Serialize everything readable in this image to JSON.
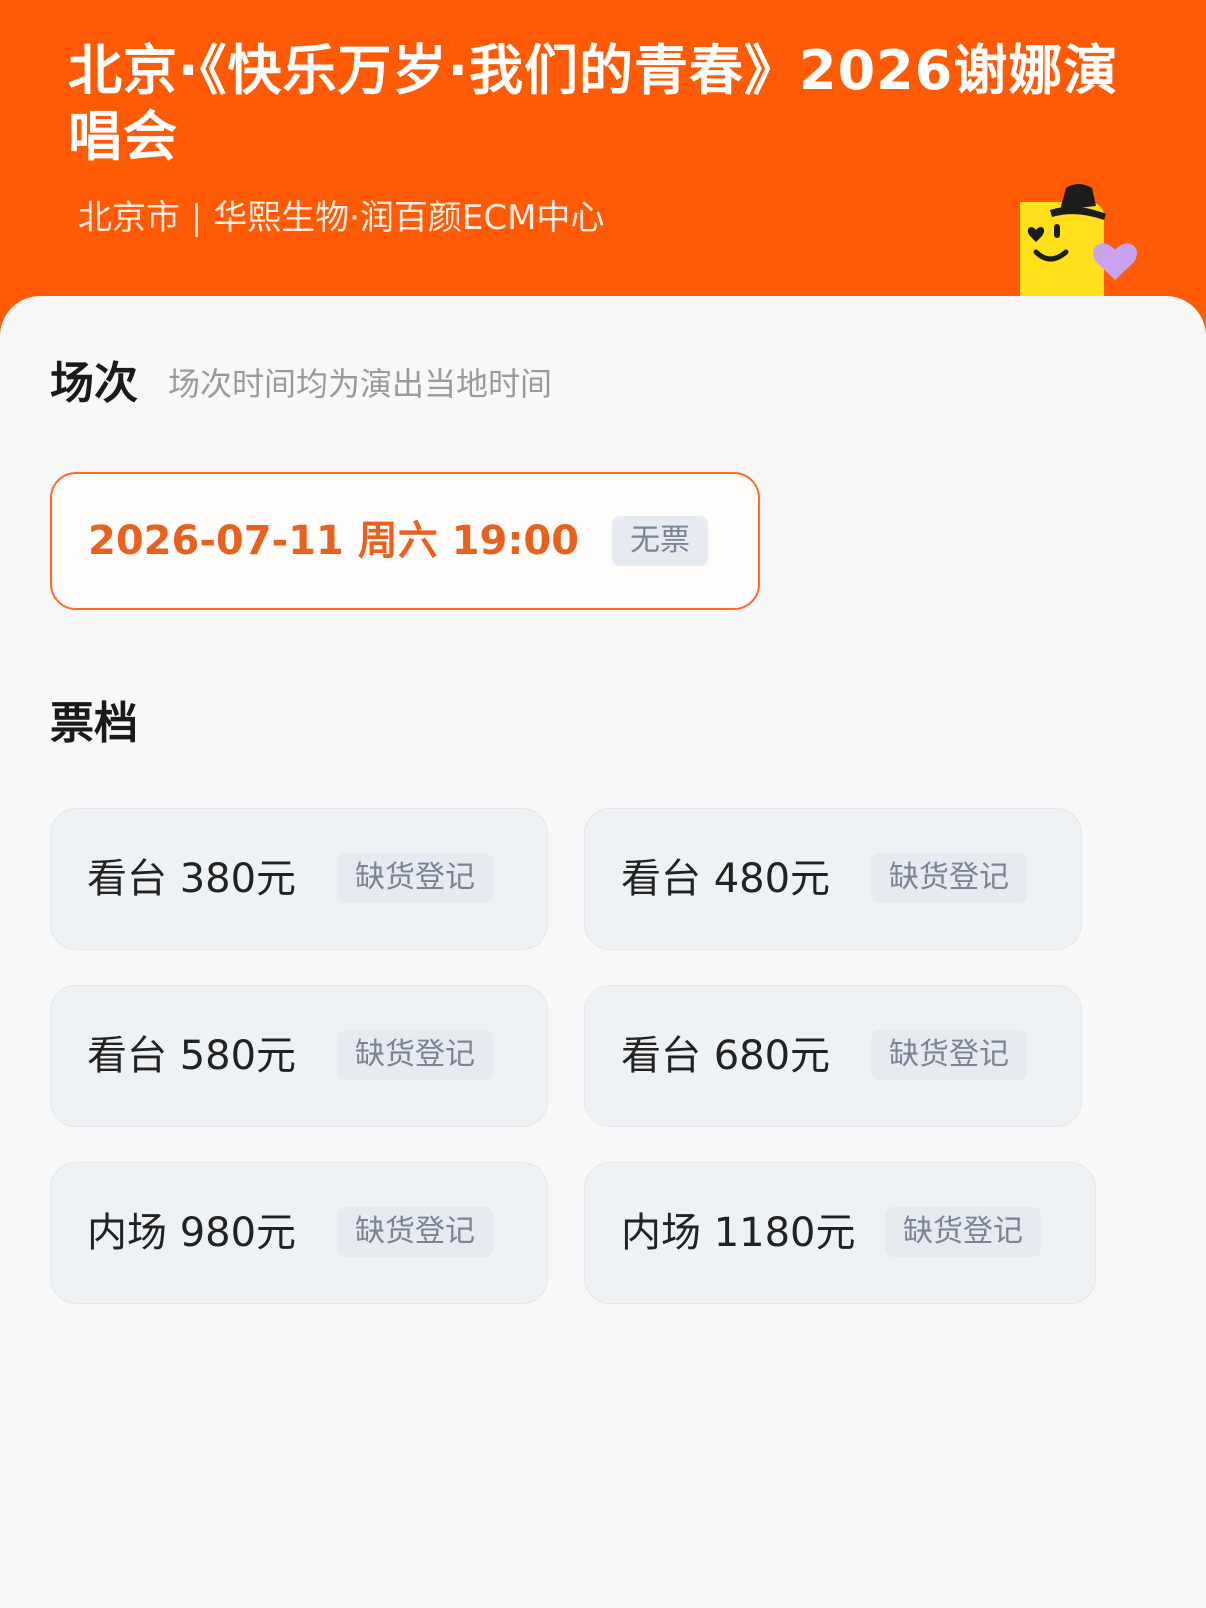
{
  "header": {
    "title": "北京·《快乐万岁·我们的青春》2026谢娜演唱会",
    "venue": "北京市 | 华熙生物·润百颜ECM中心"
  },
  "sessions": {
    "title": "场次",
    "hint": "场次时间均为演出当地时间",
    "items": [
      {
        "datetime": "2026-07-11  周六 19:00",
        "status": "无票"
      }
    ]
  },
  "tiers": {
    "title": "票档",
    "items": [
      {
        "label": "看台 380元",
        "status": "缺货登记"
      },
      {
        "label": "看台 480元",
        "status": "缺货登记"
      },
      {
        "label": "看台 580元",
        "status": "缺货登记"
      },
      {
        "label": "看台 680元",
        "status": "缺货登记"
      },
      {
        "label": "内场 980元",
        "status": "缺货登记"
      },
      {
        "label": "内场 1180元",
        "status": "缺货登记"
      }
    ]
  },
  "colors": {
    "header_bg": "#ff5a05",
    "accent": "#e8621f",
    "badge_bg": "#e7ebf1",
    "badge_text": "#7b8496"
  },
  "icons": [
    "mascot-illustration",
    "heart-icon"
  ]
}
